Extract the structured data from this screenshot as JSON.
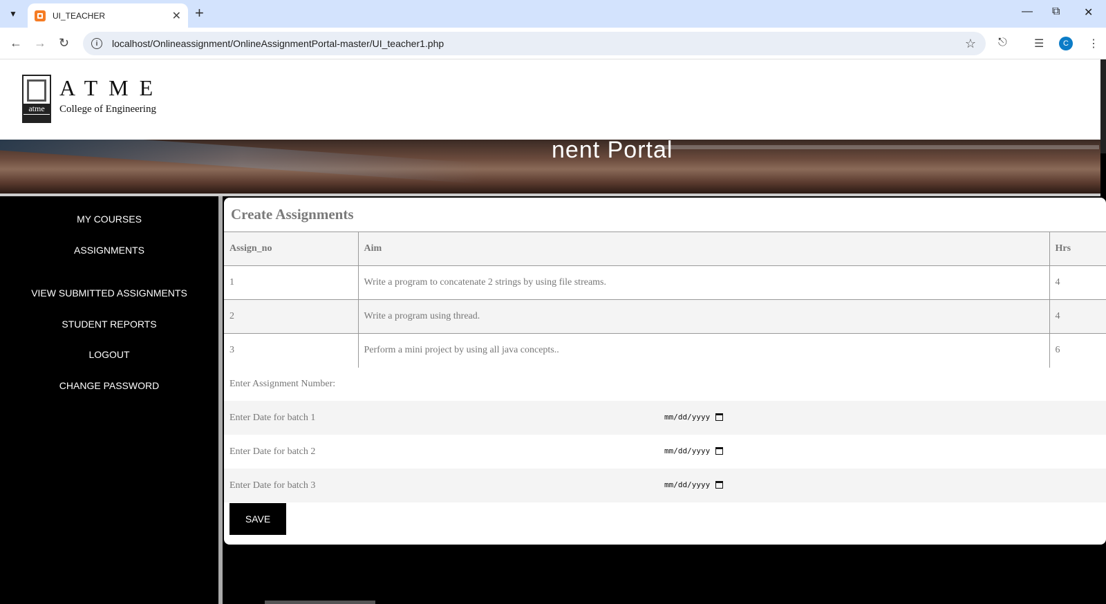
{
  "browser": {
    "tab_title": "UI_TEACHER",
    "url": "localhost/Onlineassignment/OnlineAssignmentPortal-master/UI_teacher1.php",
    "avatar_letter": "C"
  },
  "header": {
    "logo_big": "ATME",
    "logo_mark_word": "atme",
    "logo_small": "College of Engineering"
  },
  "banner": {
    "title": "nent Portal"
  },
  "sidebar": {
    "items": [
      {
        "label": "MY COURSES"
      },
      {
        "label": "ASSIGNMENTS"
      },
      {
        "label": "VIEW SUBMITTED ASSIGNMENTS"
      },
      {
        "label": "STUDENT REPORTS"
      },
      {
        "label": "LOGOUT"
      },
      {
        "label": "CHANGE PASSWORD"
      }
    ]
  },
  "main": {
    "title": "Create Assignments",
    "columns": [
      "Assign_no",
      "Aim",
      "Hrs"
    ],
    "rows": [
      {
        "no": "1",
        "aim": "Write a program to concatenate 2 strings by using file streams.",
        "hrs": "4"
      },
      {
        "no": "2",
        "aim": "Write a program using thread.",
        "hrs": "4"
      },
      {
        "no": "3",
        "aim": "Perform a mini project by using all java concepts..",
        "hrs": "6"
      }
    ],
    "form": {
      "assignment_label": "Enter Assignment Number:",
      "batch1_label": "Enter Date for batch 1",
      "batch2_label": "Enter Date for batch 2",
      "batch3_label": "Enter Date for batch 3",
      "date_placeholder": "mm/dd/yyyy",
      "save_label": "SAVE"
    }
  }
}
